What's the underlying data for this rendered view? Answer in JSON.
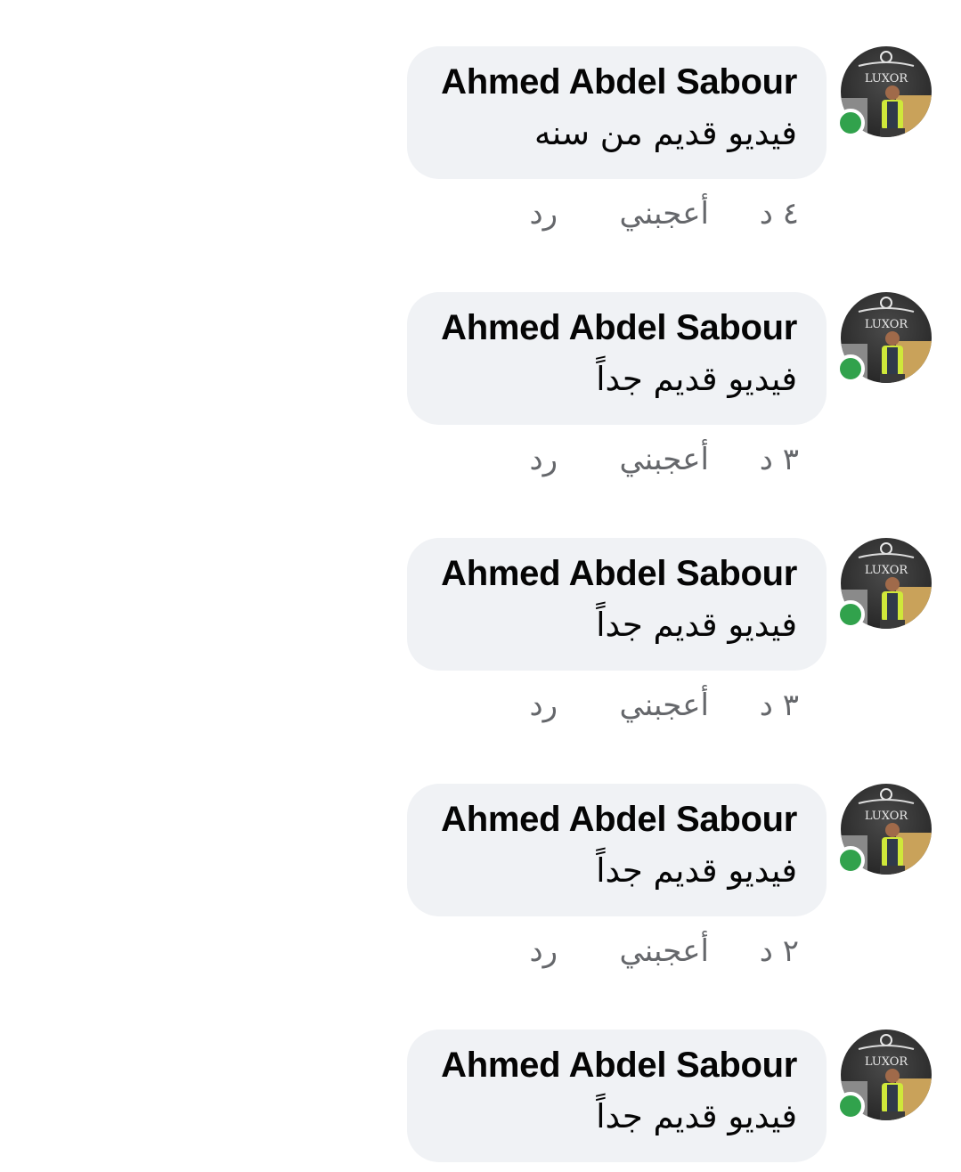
{
  "comments": [
    {
      "author": "Ahmed Abdel Sabour",
      "text": "فيديو قديم من سنه",
      "time": "٤ د",
      "like_label": "أعجبني",
      "reply_label": "رد",
      "online": true
    },
    {
      "author": "Ahmed Abdel Sabour",
      "text": "فيديو قديم جداً",
      "time": "٣ د",
      "like_label": "أعجبني",
      "reply_label": "رد",
      "online": true
    },
    {
      "author": "Ahmed Abdel Sabour",
      "text": "فيديو قديم جداً",
      "time": "٣ د",
      "like_label": "أعجبني",
      "reply_label": "رد",
      "online": true
    },
    {
      "author": "Ahmed Abdel Sabour",
      "text": "فيديو قديم جداً",
      "time": "٢ د",
      "like_label": "أعجبني",
      "reply_label": "رد",
      "online": true
    },
    {
      "author": "Ahmed Abdel Sabour",
      "text": "فيديو قديم جداً",
      "time": "",
      "like_label": "",
      "reply_label": "",
      "online": true
    }
  ],
  "avatar": {
    "logo_text": "LUXOR"
  },
  "colors": {
    "bubble": "#f0f2f5",
    "name": "#050505",
    "meta": "#65676b",
    "online": "#31a24c"
  }
}
